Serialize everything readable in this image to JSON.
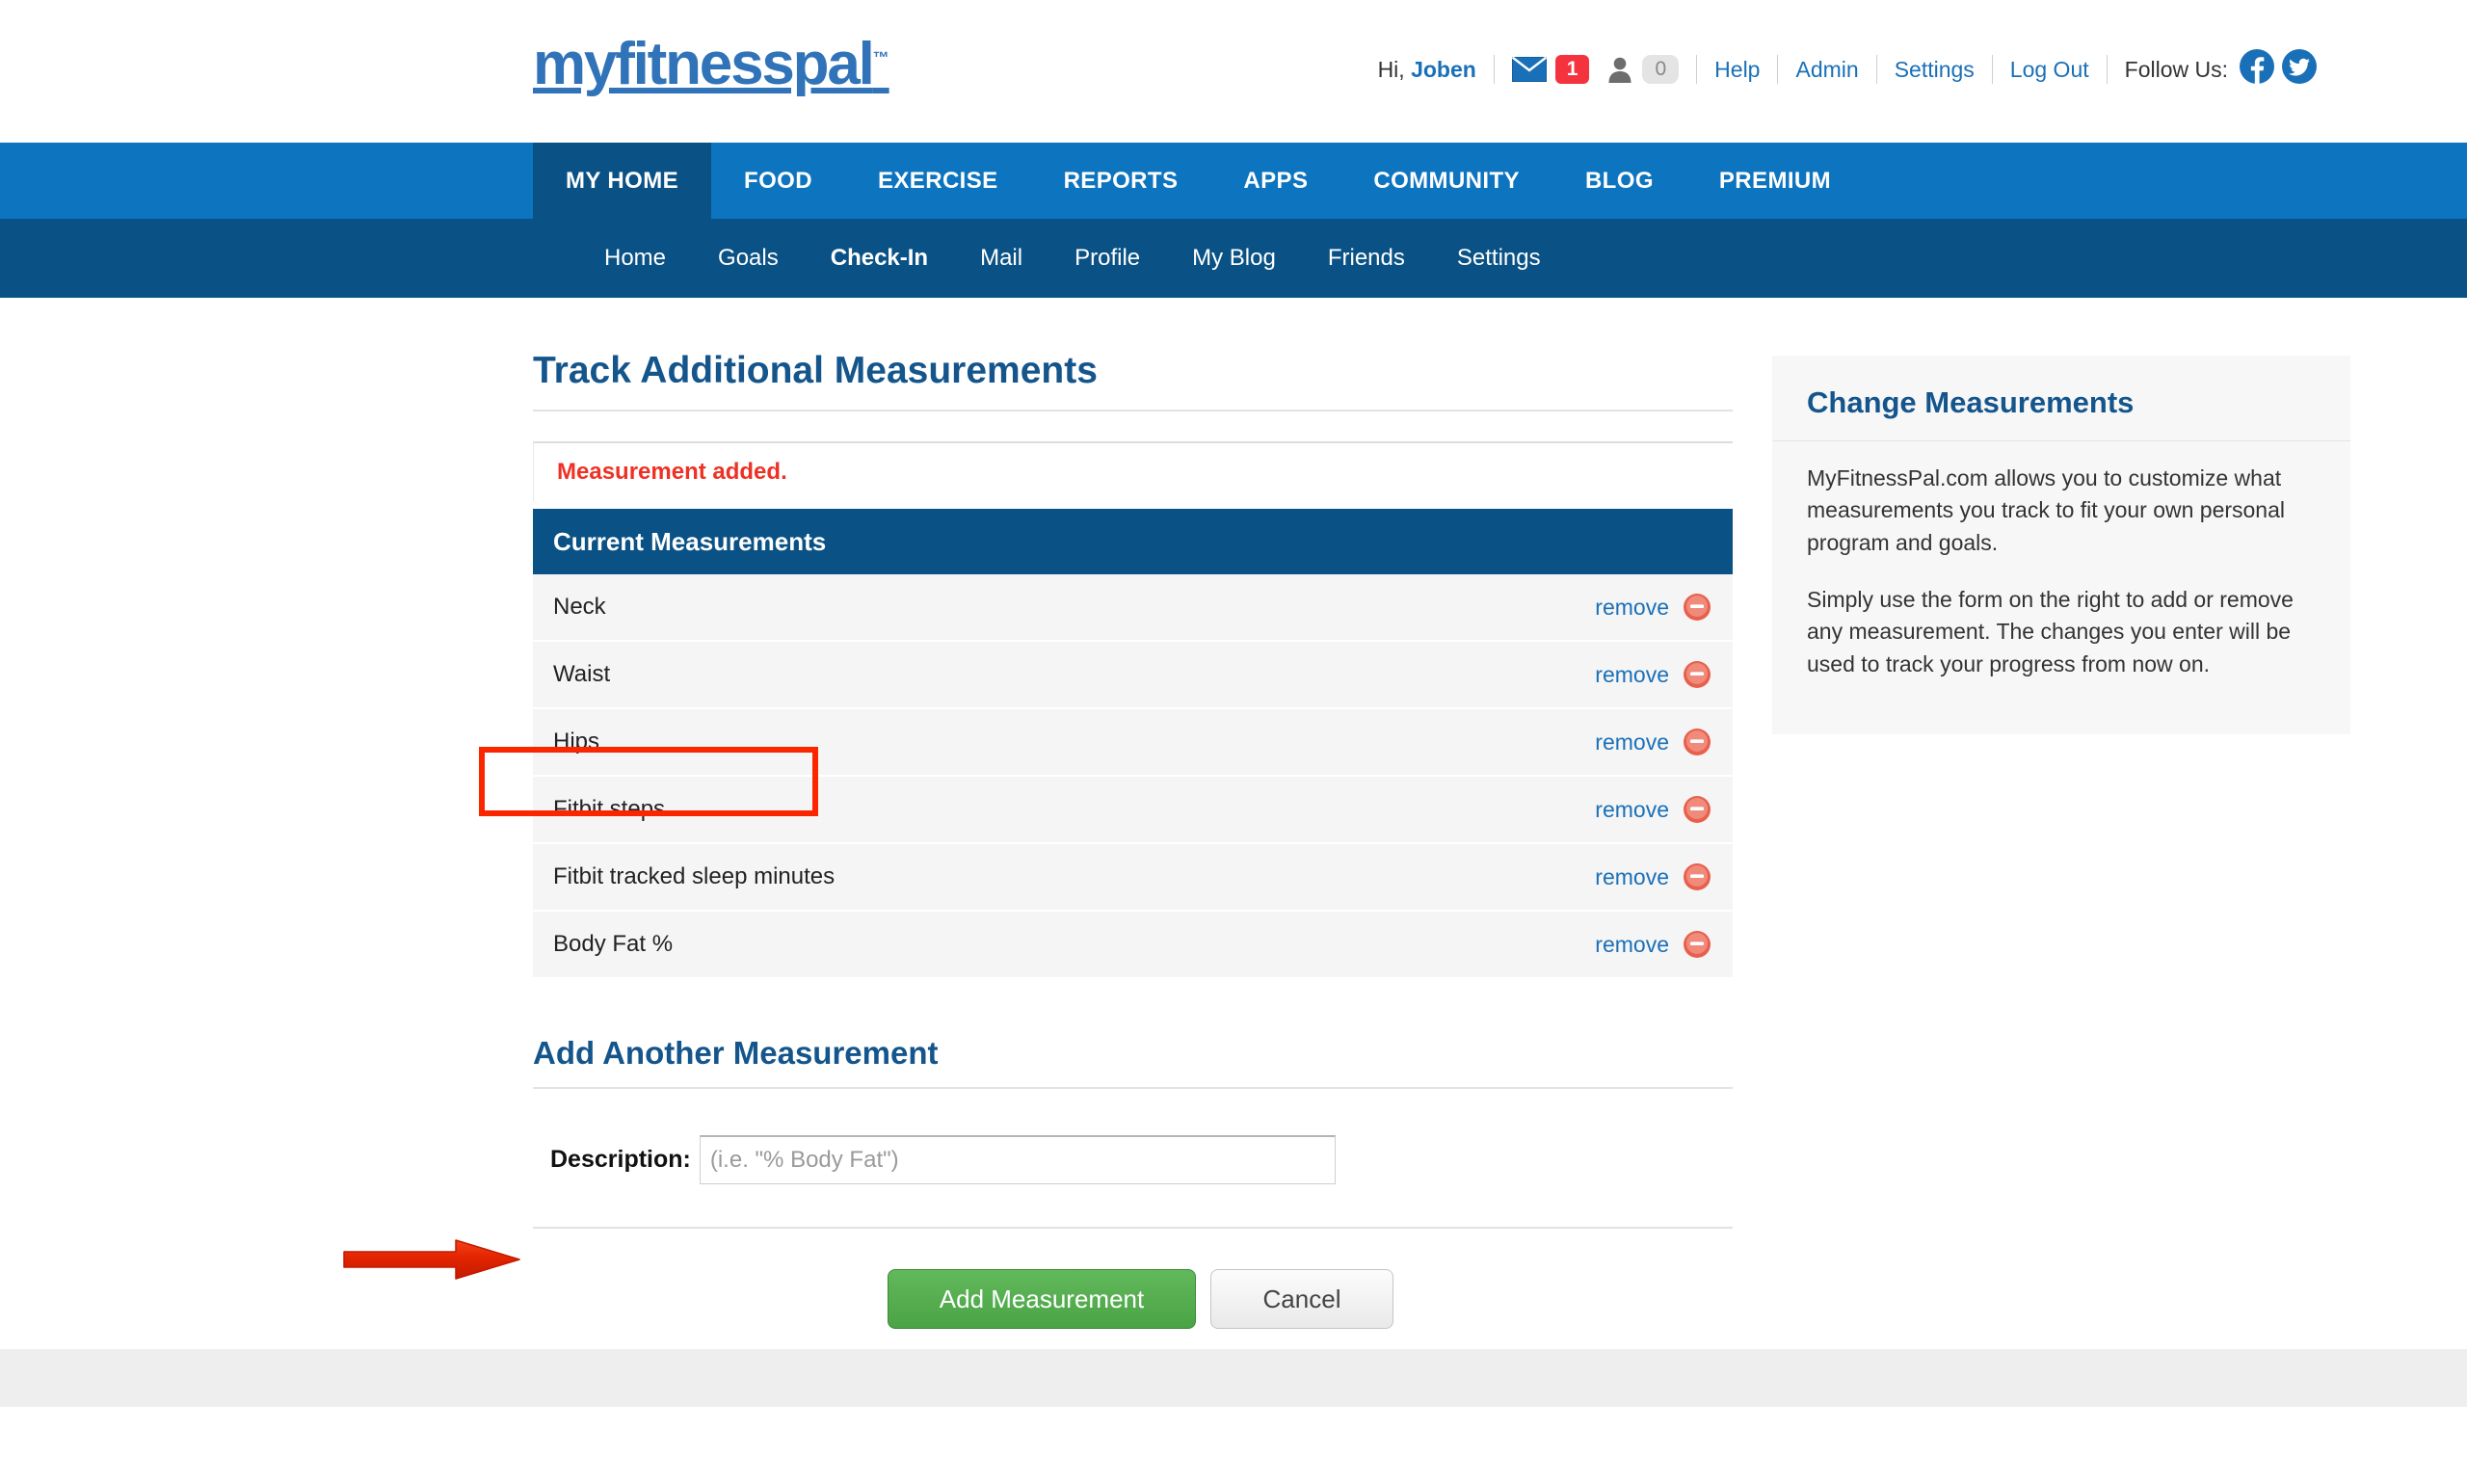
{
  "brand": {
    "logo_text": "myfitnesspal",
    "trademark": "™",
    "logo_color": "#3173b8"
  },
  "header": {
    "greeting_prefix": "Hi, ",
    "username": "Joben",
    "message_icon": "envelope-icon",
    "message_count": "1",
    "friend_icon": "person-icon",
    "friend_count": "0",
    "links": [
      {
        "label": "Help"
      },
      {
        "label": "Admin"
      },
      {
        "label": "Settings"
      },
      {
        "label": "Log Out"
      }
    ],
    "follow_label": "Follow Us:",
    "social": [
      {
        "name": "facebook-icon",
        "glyph": "f"
      },
      {
        "name": "twitter-icon",
        "glyph": "t"
      }
    ]
  },
  "main_nav": {
    "active": "MY HOME",
    "items": [
      {
        "label": "MY HOME"
      },
      {
        "label": "FOOD"
      },
      {
        "label": "EXERCISE"
      },
      {
        "label": "REPORTS"
      },
      {
        "label": "APPS"
      },
      {
        "label": "COMMUNITY"
      },
      {
        "label": "BLOG"
      },
      {
        "label": "PREMIUM"
      }
    ],
    "bg_color": "#0d74bf",
    "active_color": "#0a5285"
  },
  "sub_nav": {
    "active": "Check-In",
    "items": [
      {
        "label": "Home"
      },
      {
        "label": "Goals"
      },
      {
        "label": "Check-In"
      },
      {
        "label": "Mail"
      },
      {
        "label": "Profile"
      },
      {
        "label": "My Blog"
      },
      {
        "label": "Friends"
      },
      {
        "label": "Settings"
      }
    ],
    "bg_color": "#0a5285"
  },
  "main": {
    "page_title": "Track Additional Measurements",
    "alert": {
      "text": "Measurement added.",
      "color": "#ee3124"
    },
    "table": {
      "header": "Current Measurements",
      "header_bg": "#0a5285",
      "remove_label": "remove",
      "rows": [
        {
          "name": "Neck"
        },
        {
          "name": "Waist"
        },
        {
          "name": "Hips"
        },
        {
          "name": "Fitbit steps"
        },
        {
          "name": "Fitbit tracked sleep minutes"
        },
        {
          "name": "Body Fat %"
        }
      ]
    },
    "add_form": {
      "title": "Add Another Measurement",
      "description_label": "Description:",
      "description_value": "",
      "description_placeholder": "(i.e. \"% Body Fat\")",
      "submit_label": "Add Measurement",
      "cancel_label": "Cancel",
      "submit_color": "#4aa345"
    }
  },
  "sidebar": {
    "title": "Change Measurements",
    "paragraphs": [
      "MyFitnessPal.com allows you to customize what measurements you track to fit your own personal program and goals.",
      "Simply use the form on the right to add or remove any measurement. The changes you enter will be used to track your progress from now on."
    ]
  },
  "annotations": {
    "highlight_box_color": "#fa2600",
    "arrow_color": "#e02000",
    "arrow_target": "Body Fat %"
  }
}
